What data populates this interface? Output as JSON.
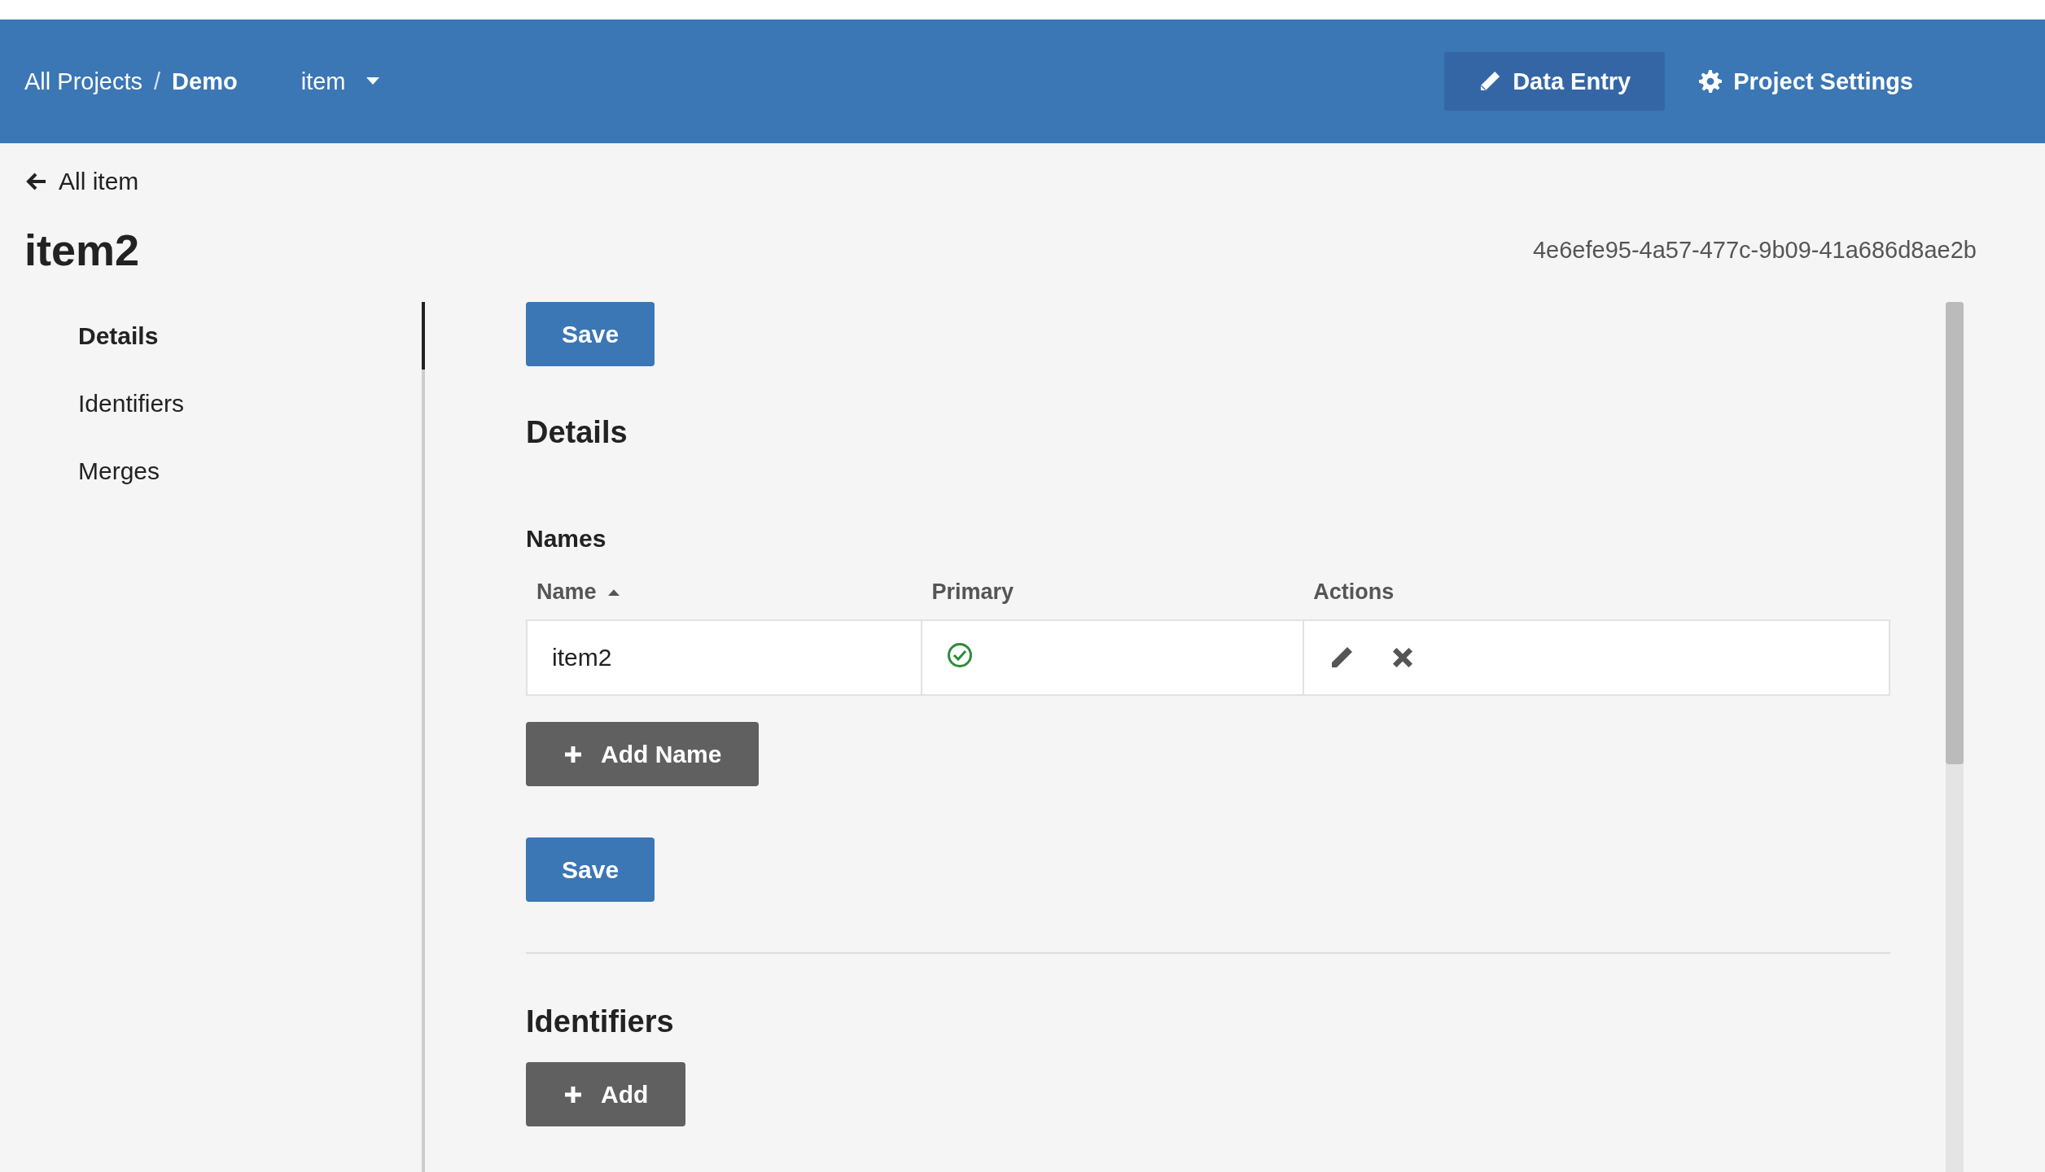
{
  "header": {
    "breadcrumb": [
      {
        "label": "All Projects",
        "current": false
      },
      {
        "label": "Demo",
        "current": true
      }
    ],
    "separator": "/",
    "type_menu": {
      "label": "item"
    },
    "nav": [
      {
        "label": "Data Entry",
        "kind": "pencil",
        "selected": true
      },
      {
        "label": "Project Settings",
        "kind": "gear",
        "selected": false
      }
    ]
  },
  "back_link": "All item",
  "title": "item2",
  "record_id": "4e6efe95-4a57-477c-9b09-41a686d8ae2b",
  "sidebar": {
    "items": [
      {
        "label": "Details",
        "selected": true
      },
      {
        "label": "Identifiers",
        "selected": false
      },
      {
        "label": "Merges",
        "selected": false
      }
    ]
  },
  "content": {
    "save_top": "Save",
    "details_heading": "Details",
    "names_heading": "Names",
    "names_table": {
      "columns": [
        {
          "label": "Name",
          "sorted": true
        },
        {
          "label": "Primary",
          "sorted": false
        },
        {
          "label": "Actions",
          "sorted": false
        }
      ],
      "rows": [
        {
          "name": "item2",
          "primary": true
        }
      ]
    },
    "add_name": "Add Name",
    "save_bottom": "Save",
    "identifiers_heading": "Identifiers",
    "add_identifier": "Add"
  }
}
